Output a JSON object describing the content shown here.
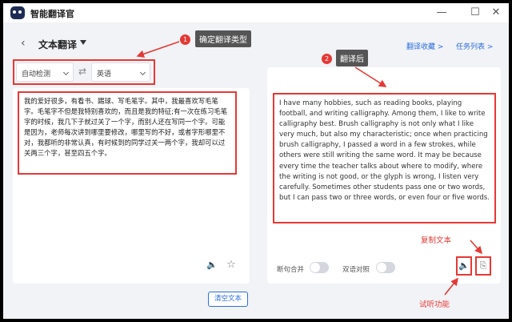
{
  "app": {
    "title": "智能翻译官"
  },
  "window_controls": {
    "min": "—",
    "max": "☐",
    "close": "✕"
  },
  "header": {
    "title": "文本翻译",
    "links": [
      "翻译收藏 >",
      "任务列表 >"
    ]
  },
  "lang": {
    "source": "自动检测",
    "target": "英语",
    "swap": "⇄"
  },
  "source_text": "我的爱好很多，有看书、踢球、写毛笔字。其中，我最喜欢写毛笔字。毛笔字不但是我特别喜欢的，而且是我的特征;有一次在练习毛笔字的时候，我几下子就过关了一个字，而别人还在写同一个字。可能是因为，老师每次讲到哪里要修改，哪里写的不好，或者字形哪里不对，我都听的非常认真，有时候到的同学过关一两个字，我却可以过关两三个字，甚至四五个字。",
  "target_text": "I have many hobbies, such as reading books, playing football, and writing calligraphy. Among them, I like to write calligraphy best. Brush calligraphy is not only what I like very much, but also my characteristic; once when practicing brush calligraphy, I passed a word in a few strokes, while others were still writing the same word. It may be because every time the teacher talks about where to modify, where the writing is not good, or the glyph is wrong, I listen very carefully. Sometimes other students pass one or two words, but I can pass two or three words, or even four or five words.",
  "controls": {
    "sentence_merge": "断句合并",
    "bilingual": "双语对照",
    "clear": "清空文本"
  },
  "icons": {
    "speaker": "🔈",
    "star": "☆",
    "copy": "⎘"
  },
  "annotations": {
    "badge1": "1",
    "label1": "确定翻译类型",
    "badge2": "2",
    "label2": "翻译后",
    "copy_text": "复制文本",
    "listen": "试听功能"
  },
  "colors": {
    "accent": "#2b6ede",
    "annotation": "#e53935"
  }
}
